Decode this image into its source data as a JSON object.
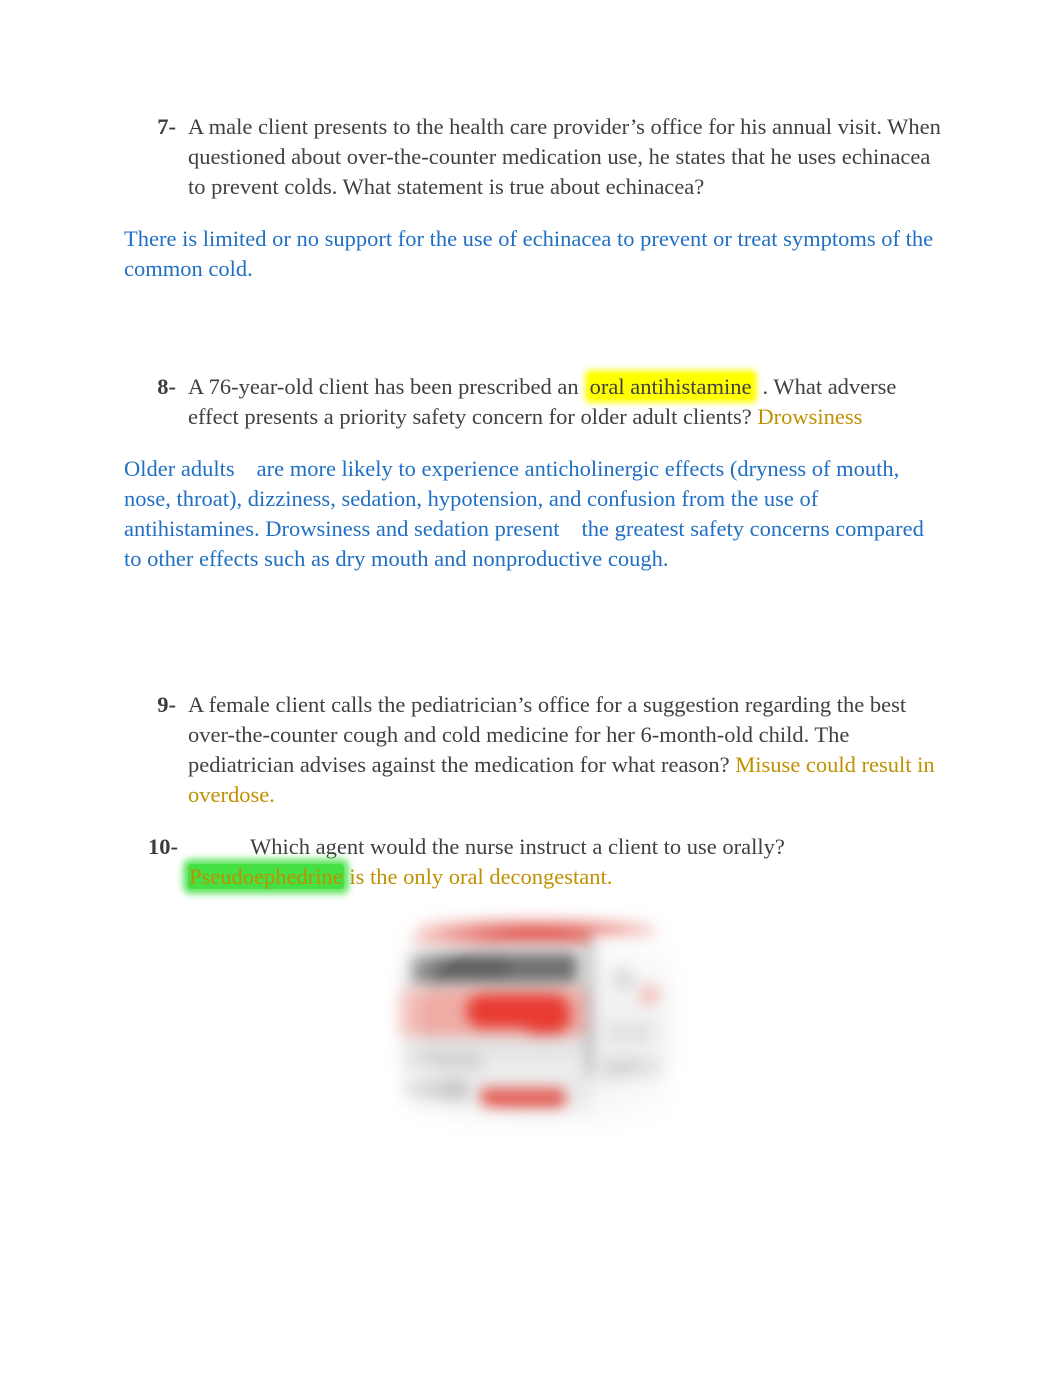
{
  "document": {
    "type": "study-notes",
    "colors": {
      "body_text": "#404040",
      "answer_blue": "#1F6FC4",
      "answer_amber": "#BF9000",
      "highlight_yellow": "#FFFF00",
      "highlight_green": "#44E044",
      "page_background": "#FFFFFF"
    }
  },
  "items": [
    {
      "number": "7-",
      "question_text": "A male client presents to the health care provider’s office for his annual visit. When questioned about over-the-counter medication use, he states that he uses echinacea to prevent colds. What statement is true about echinacea?",
      "explanation": "There is limited or no support for the use of echinacea to prevent or treat symptoms of the common cold."
    },
    {
      "number": "8-",
      "q8_part1": "A 76-year-old client has been prescribed an",
      "q8_highlight": "oral antihistamine",
      "q8_part2": ". What adverse effect presents a priority safety concern for older adult clients?",
      "q8_answer": "Drowsiness",
      "explanation_a": "Older adults",
      "explanation_b": "are more likely to experience anticholinergic effects (dryness of mouth, nose, throat), dizziness, sedation, hypotension, and confusion from the use of antihistamines. Drowsiness and sedation present",
      "explanation_c": "the greatest safety concerns compared to other effects such as dry mouth and nonproductive cough."
    },
    {
      "number": "9-",
      "q9_question": "A female client calls the pediatrician’s office for a suggestion regarding the best over-the-counter cough and cold medicine for her 6-month-old child. The pediatrician advises against the medication for what reason?",
      "q9_answer": "Misuse could result in overdose."
    },
    {
      "number": "10-",
      "q10_question": "Which agent would the nurse instruct a client to use orally?",
      "q10_answer_highlight": "Pseudoephedrine",
      "q10_answer_rest": "is the only oral decongestant."
    }
  ],
  "figure": {
    "caption": "",
    "description": "blurred photograph of an over-the-counter decongestant medication package in red and white with blister pack"
  }
}
